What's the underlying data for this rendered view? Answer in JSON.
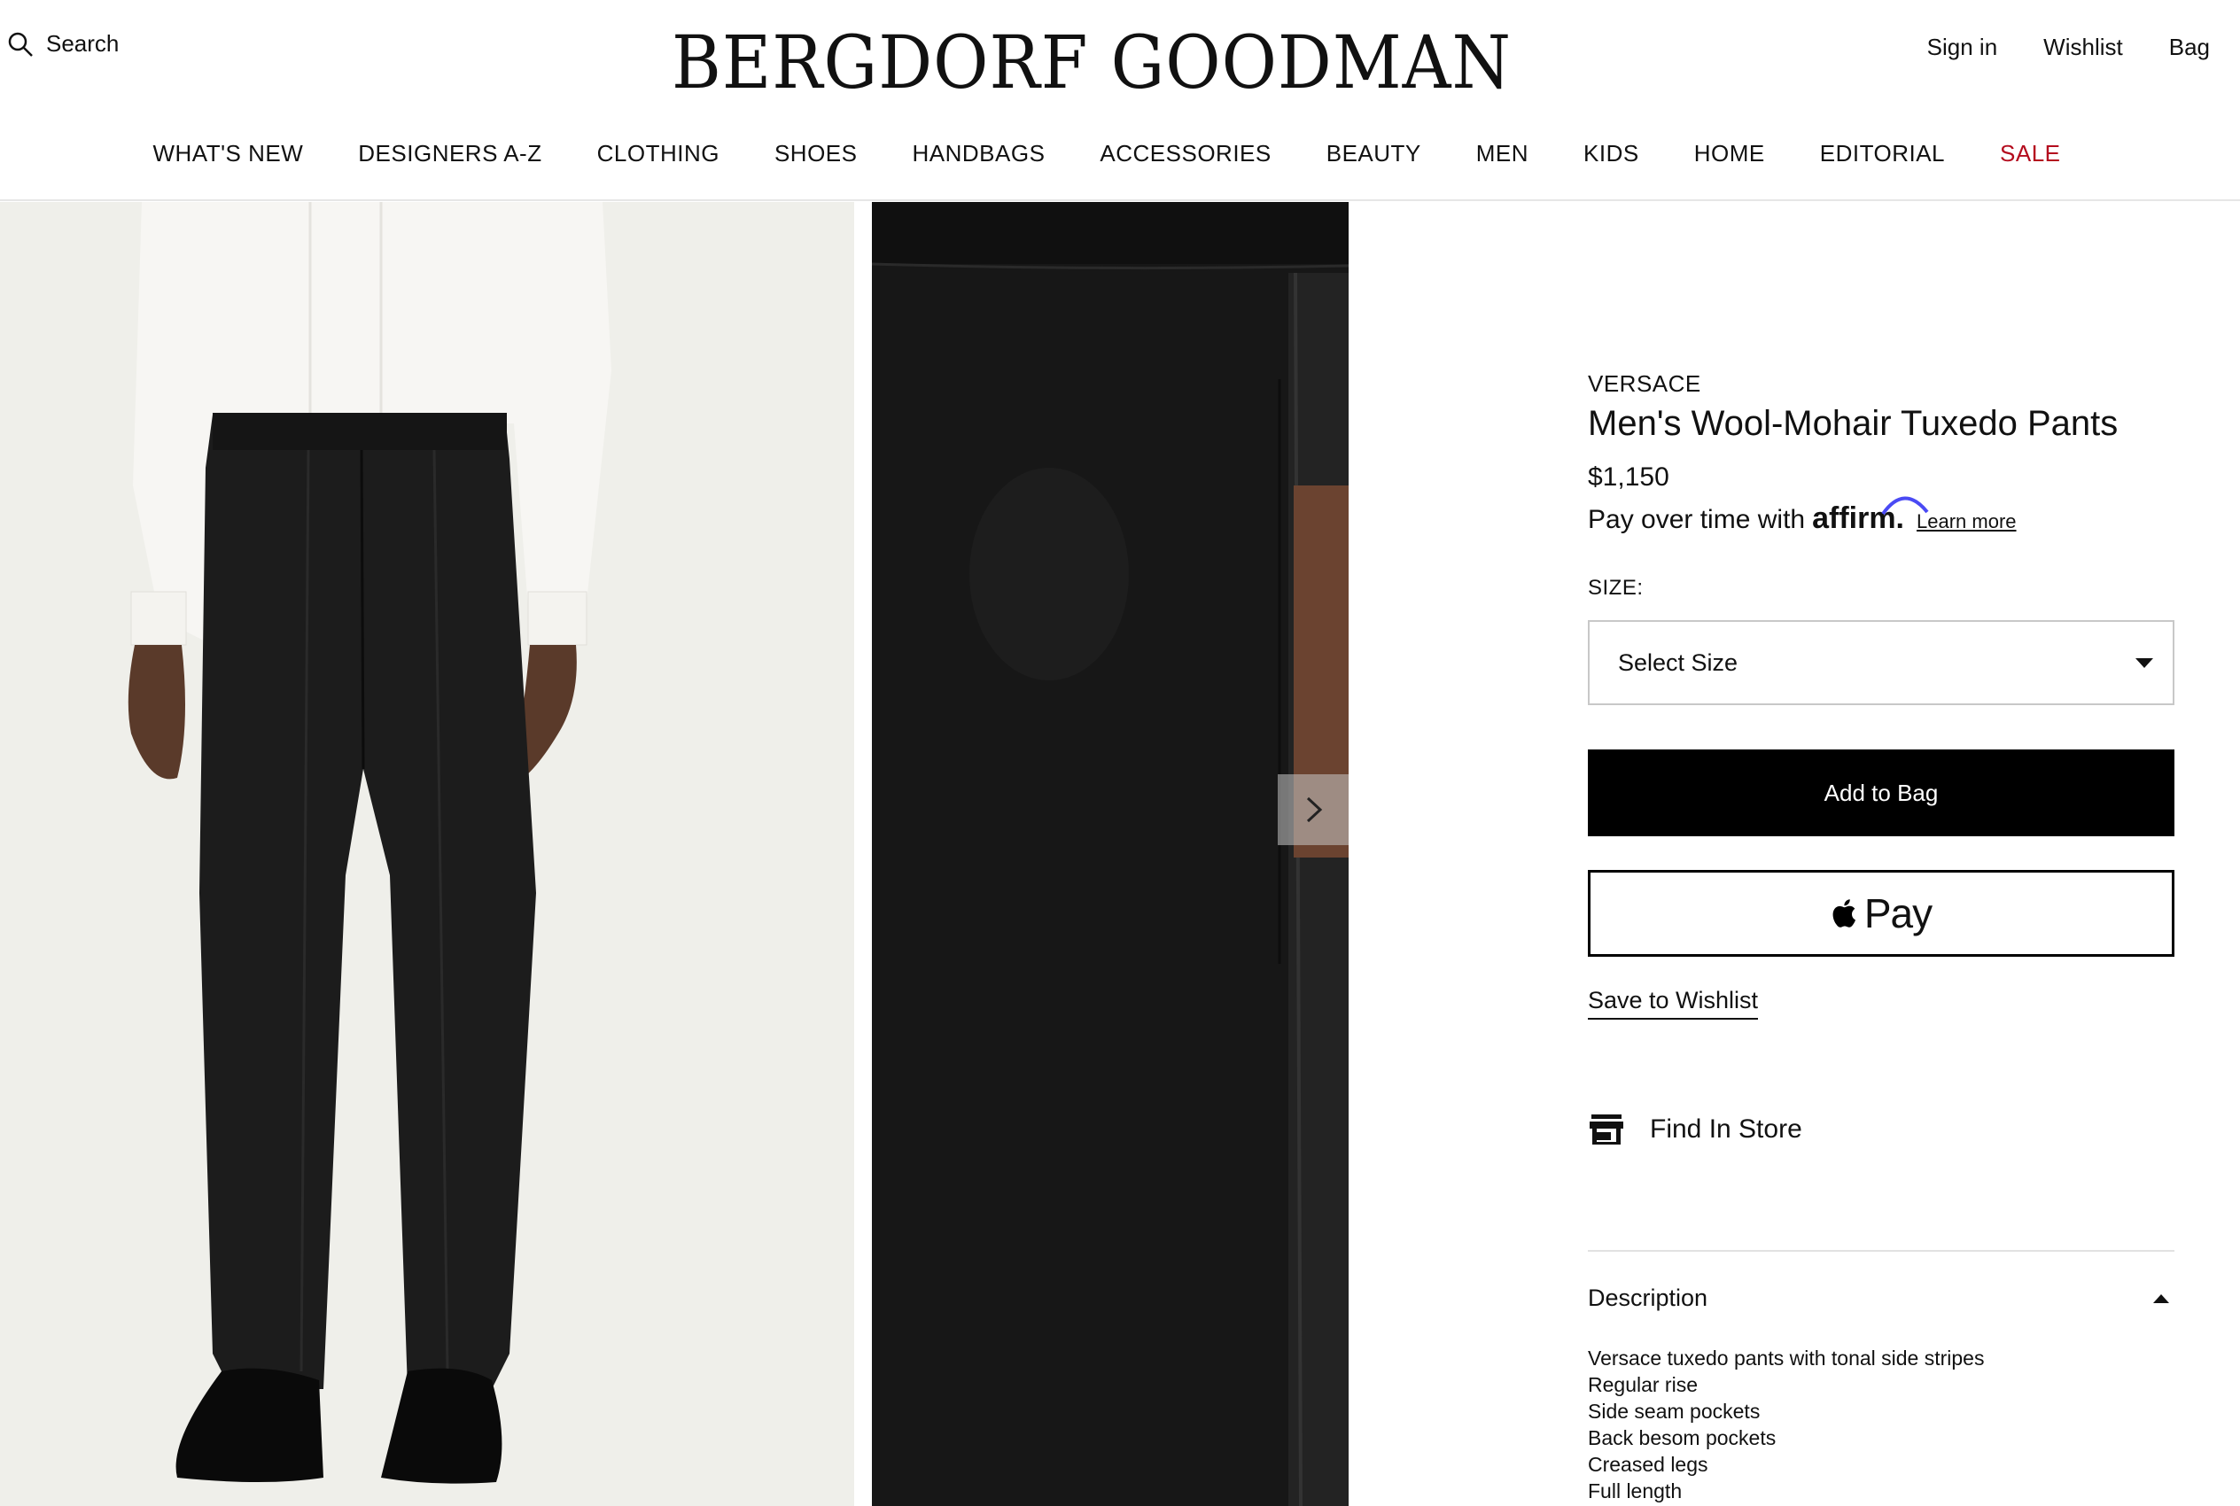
{
  "header": {
    "search_label": "Search",
    "logo": "BERGDORF GOODMAN",
    "account": {
      "sign_in": "Sign in",
      "wishlist": "Wishlist",
      "bag": "Bag"
    }
  },
  "nav": {
    "items": [
      "WHAT'S NEW",
      "DESIGNERS A-Z",
      "CLOTHING",
      "SHOES",
      "HANDBAGS",
      "ACCESSORIES",
      "BEAUTY",
      "MEN",
      "KIDS",
      "HOME",
      "EDITORIAL",
      "SALE"
    ],
    "sale_color": "#b40c1e"
  },
  "product": {
    "brand": "VERSACE",
    "title": "Men's Wool-Mohair Tuxedo Pants",
    "price": "$1,150",
    "affirm_text": "Pay over time with",
    "affirm_logo": "affirm.",
    "affirm_link": "Learn more",
    "size_label": "SIZE:",
    "size_select": "Select Size",
    "add_to_bag": "Add to Bag",
    "apple_pay": "Pay",
    "save_wishlist": "Save to Wishlist",
    "find_store": "Find In Store",
    "description_title": "Description",
    "description": [
      "Versace tuxedo pants with tonal side stripes",
      "Regular rise",
      "Side seam pockets",
      "Back besom pockets",
      "Creased legs",
      "Full length"
    ]
  },
  "colors": {
    "affirm_arc": "#4a4af4",
    "button_bg": "#000000"
  },
  "icons": {
    "search": "search-icon",
    "next": "chevron-right-icon",
    "apple": "apple-icon",
    "store": "store-icon"
  }
}
